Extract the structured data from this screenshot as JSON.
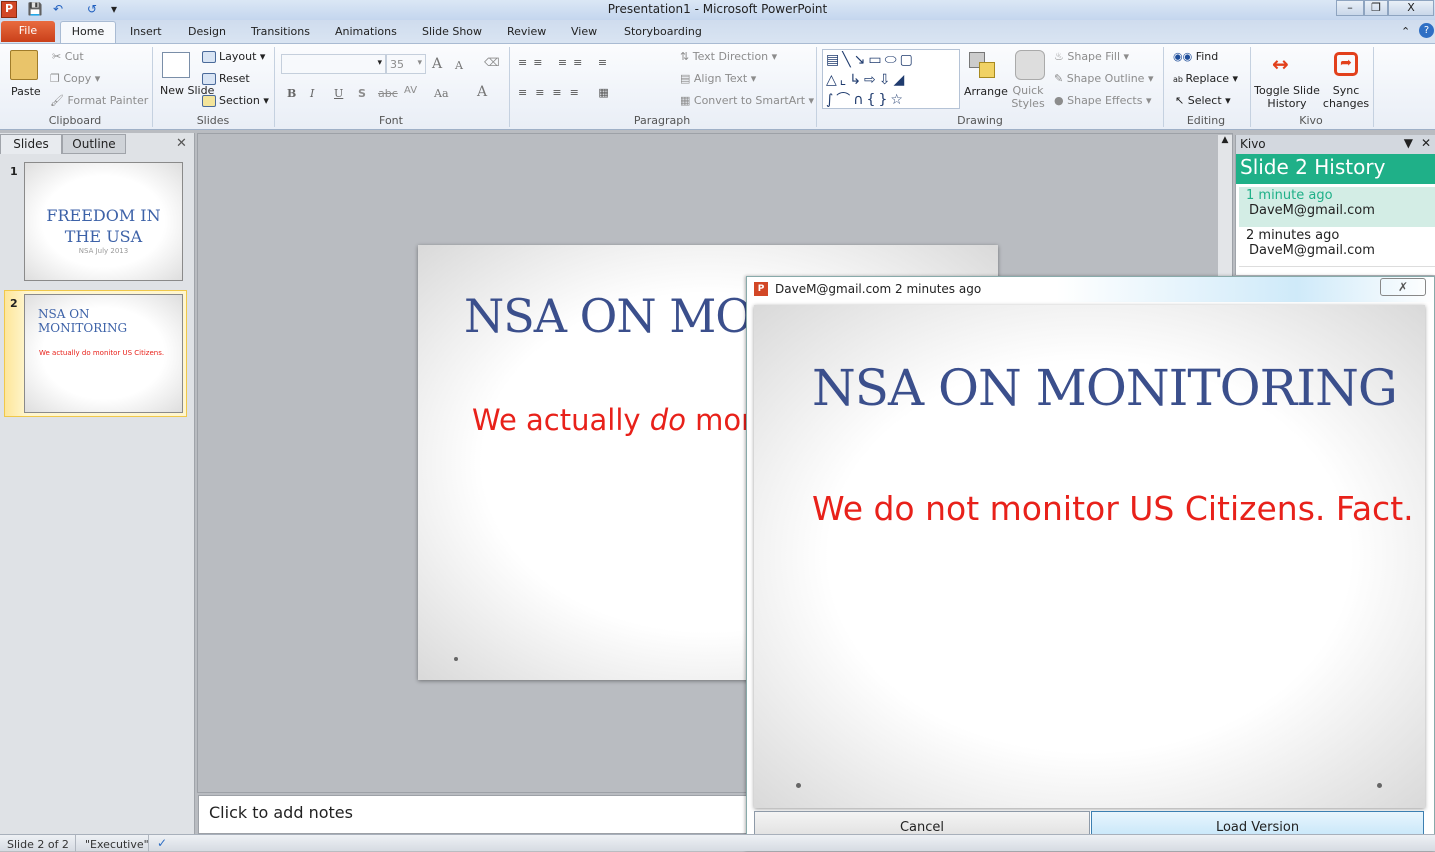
{
  "window": {
    "title": "Presentation1  -  Microsoft PowerPoint"
  },
  "tabs": [
    "File",
    "Home",
    "Insert",
    "Design",
    "Transitions",
    "Animations",
    "Slide Show",
    "Review",
    "View",
    "Storyboarding"
  ],
  "ribbon": {
    "clipboard": {
      "label": "Clipboard",
      "paste": "Paste",
      "cut": "Cut",
      "copy": "Copy",
      "format_painter": "Format Painter"
    },
    "slides": {
      "label": "Slides",
      "new_slide": "New Slide",
      "layout": "Layout",
      "reset": "Reset",
      "section": "Section"
    },
    "font": {
      "label": "Font",
      "font_name": "",
      "font_size": "35",
      "bold": "B",
      "italic": "I",
      "underline": "U",
      "shadow": "S",
      "strike": "abc",
      "spacing": "AV",
      "case": "Aa",
      "color": "A",
      "grow": "A",
      "shrink": "A"
    },
    "paragraph": {
      "label": "Paragraph",
      "text_direction": "Text Direction",
      "align_text": "Align Text",
      "convert_smartart": "Convert to SmartArt"
    },
    "drawing": {
      "label": "Drawing",
      "arrange": "Arrange",
      "quick_styles": "Quick Styles",
      "shape_fill": "Shape Fill",
      "shape_outline": "Shape Outline",
      "shape_effects": "Shape Effects"
    },
    "editing": {
      "label": "Editing",
      "find": "Find",
      "replace": "Replace",
      "select": "Select"
    },
    "kivo": {
      "label": "Kivo",
      "toggle": "Toggle Slide History",
      "sync": "Sync changes"
    }
  },
  "slide_pane": {
    "tabs": [
      "Slides",
      "Outline"
    ],
    "slides": [
      {
        "num": "1",
        "title": "FREEDOM  IN THE USA",
        "subtitle": "NSA July 2013"
      },
      {
        "num": "2",
        "title": "NSA ON MONITORING",
        "body": "We actually do monitor US Citizens."
      }
    ]
  },
  "main_slide": {
    "title": "NSA ON MON",
    "body_pre": "We actually ",
    "body_em": "do",
    "body_post": " mon"
  },
  "notes": {
    "placeholder": "Click to add notes"
  },
  "kivo_panel": {
    "title": "Kivo",
    "header": "Slide 2 History",
    "entries": [
      {
        "time": "1 minute ago",
        "user": "DaveM@gmail.com"
      },
      {
        "time": "2 minutes ago",
        "user": "DaveM@gmail.com"
      }
    ]
  },
  "dialog": {
    "title": "DaveM@gmail.com 2 minutes ago",
    "slide_title": "NSA ON MONITORING",
    "slide_body": "We do not monitor US Citizens. Fact.",
    "cancel": "Cancel",
    "load": "Load Version"
  },
  "status": {
    "slide": "Slide 2 of 2",
    "theme": "\"Executive\""
  },
  "colors": {
    "kivo_green": "#1fb088",
    "accent_red": "#e8211a",
    "title_blue": "#3b4f8c"
  }
}
